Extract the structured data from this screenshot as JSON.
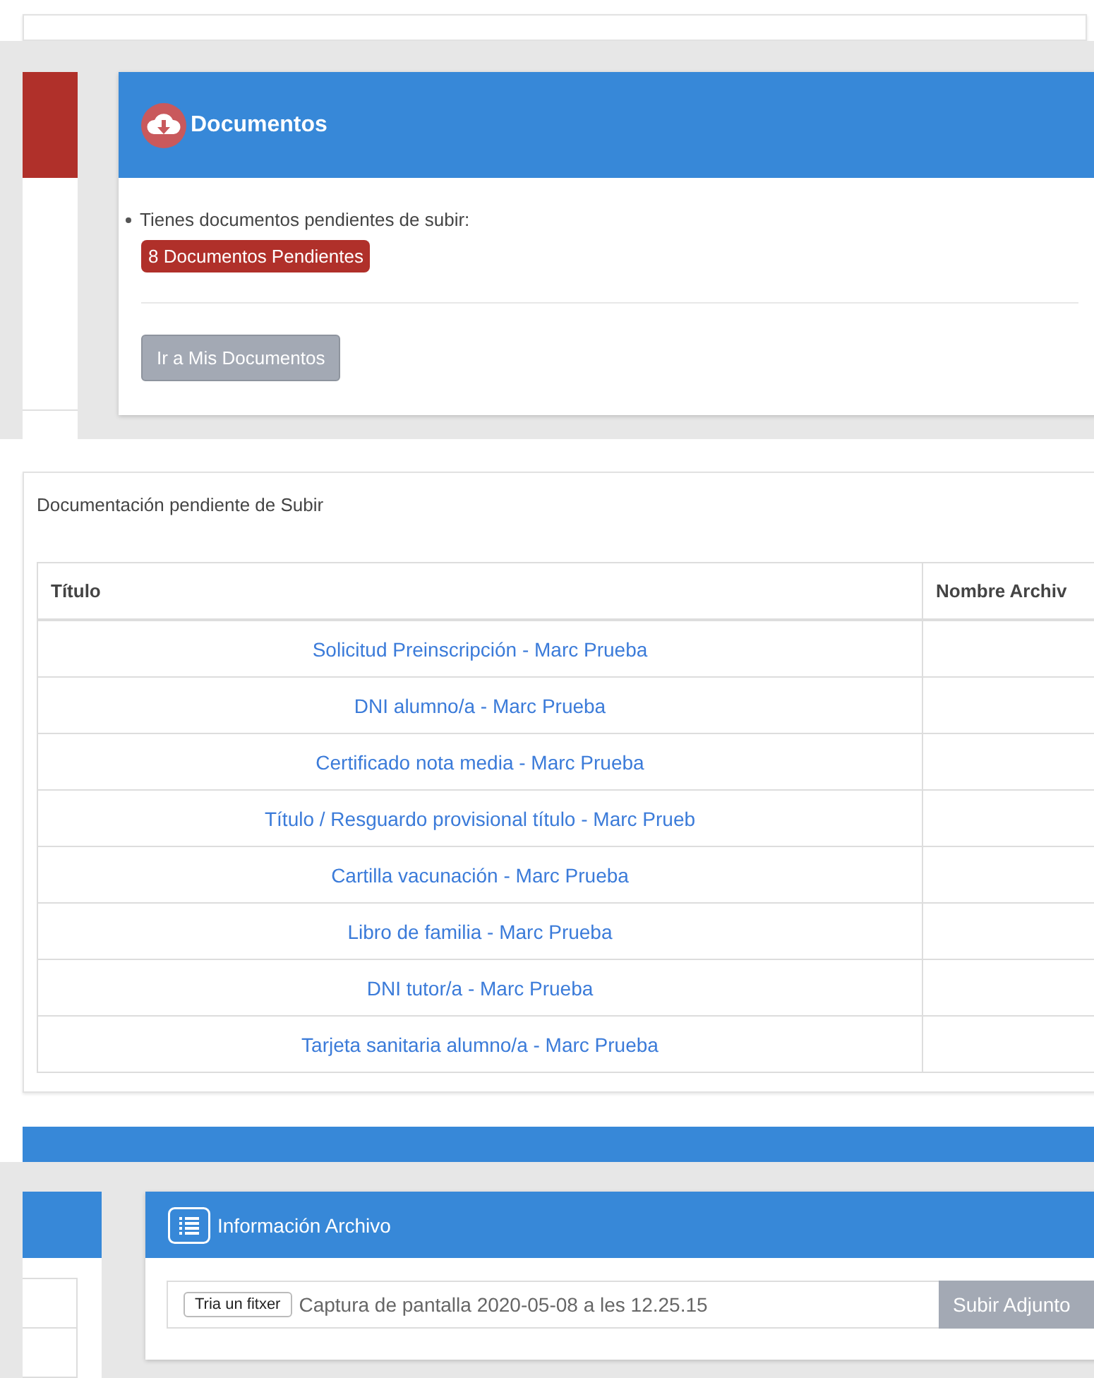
{
  "documents_card": {
    "title": "Documentos",
    "message": "Tienes documentos pendientes de subir:",
    "badge": "8 Documentos Pendientes",
    "button": {
      "label": "Ir a Mis Documentos",
      "disabled": true
    }
  },
  "pending_table": {
    "caption": "Documentación pendiente de Subir",
    "columns": [
      "Título",
      "Nombre Archiv"
    ],
    "rows": [
      {
        "title": "Solicitud Preinscripción - Marc Prueba"
      },
      {
        "title": "DNI alumno/a - Marc Prueba"
      },
      {
        "title": "Certificado nota media - Marc Prueba"
      },
      {
        "title": "Título / Resguardo provisional título - Marc Prueb"
      },
      {
        "title": "Cartilla vacunación - Marc Prueba"
      },
      {
        "title": "Libro de familia - Marc Prueba"
      },
      {
        "title": "DNI tutor/a - Marc Prueba"
      },
      {
        "title": "Tarjeta sanitaria alumno/a - Marc Prueba"
      }
    ]
  },
  "file_card": {
    "title": "Información Archivo",
    "choose_button": "Tria un fitxer",
    "file_name": "Captura de pantalla 2020-05-08 a les 12.25.15",
    "upload_button": {
      "label": "Subir Adjunto",
      "disabled": true
    }
  }
}
